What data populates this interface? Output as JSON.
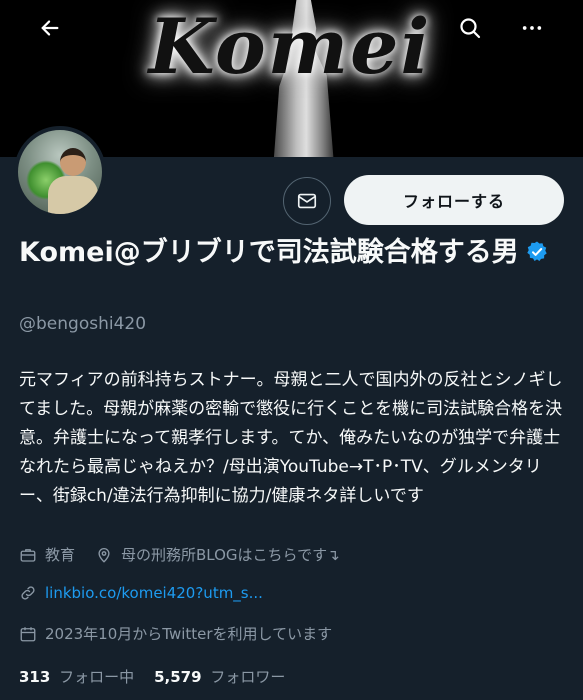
{
  "banner": {
    "title": "Komei"
  },
  "header": {
    "back_icon": "arrow-left-icon",
    "search_icon": "search-icon",
    "more_icon": "more-icon"
  },
  "actions": {
    "message_icon": "mail-icon",
    "follow_label": "フォローする"
  },
  "profile": {
    "name": "Komei@ブリブリで司法試験合格する男",
    "verified": true,
    "handle": "@bengoshi420",
    "bio": "元マフィアの前科持ちストナー。母親と二人で国内外の反社とシノギしてました。母親が麻薬の密輸で懲役に行くことを機に司法試験合格を決意。弁護士になって親孝行します。てか、俺みたいなのが独学で弁護士なれたら最高じゃねえか？/母出演YouTube→T･P･TV、グルメンタリー、街録ch/違法行為抑制に協力/健康ネタ詳しいです"
  },
  "meta": {
    "category": "教育",
    "location": "母の刑務所BLOGはこちらです↴",
    "link": "linkbio.co/komei420?utm_s...",
    "joined": "2023年10月からTwitterを利用しています"
  },
  "stats": {
    "following_count": "313",
    "following_label": "フォロー中",
    "followers_count": "5,579",
    "followers_label": "フォロワー"
  },
  "colors": {
    "background": "#15202b",
    "accent": "#1d9bf0",
    "muted": "#8b98a5",
    "button_bg": "#eff3f4"
  }
}
